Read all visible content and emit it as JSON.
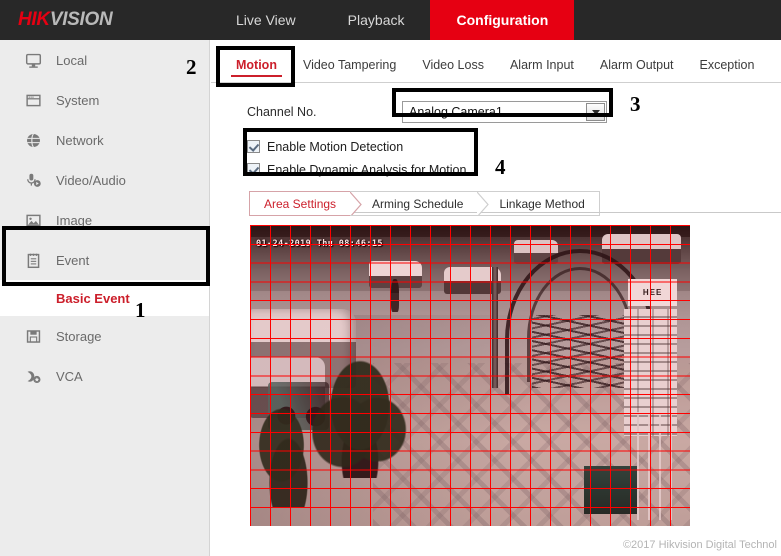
{
  "header": {
    "logo_hik": "HIK",
    "logo_vision": "VISION",
    "nav": [
      {
        "label": "Live View",
        "active": false
      },
      {
        "label": "Playback",
        "active": false
      },
      {
        "label": "Configuration",
        "active": true
      }
    ],
    "accent_color": "#e60012",
    "bar_color": "#282828"
  },
  "sidebar": {
    "items": [
      {
        "label": "Local",
        "icon": "monitor-icon"
      },
      {
        "label": "System",
        "icon": "window-icon"
      },
      {
        "label": "Network",
        "icon": "globe-icon"
      },
      {
        "label": "Video/Audio",
        "icon": "microphone-icon"
      },
      {
        "label": "Image",
        "icon": "picture-icon"
      },
      {
        "label": "Event",
        "icon": "clipboard-icon"
      },
      {
        "label": "Storage",
        "icon": "floppy-disk-icon"
      },
      {
        "label": "VCA",
        "icon": "vca-icon"
      }
    ],
    "sub_item": {
      "label": "Basic Event",
      "active": true,
      "color": "#cc1f2b"
    }
  },
  "tabs": [
    {
      "label": "Motion",
      "active": true
    },
    {
      "label": "Video Tampering",
      "active": false
    },
    {
      "label": "Video Loss",
      "active": false
    },
    {
      "label": "Alarm Input",
      "active": false
    },
    {
      "label": "Alarm Output",
      "active": false
    },
    {
      "label": "Exception",
      "active": false
    }
  ],
  "channel": {
    "label": "Channel No.",
    "selected": "Analog Camera1",
    "options": [
      "Analog Camera1"
    ]
  },
  "checkboxes": [
    {
      "label": "Enable Motion Detection",
      "checked": true
    },
    {
      "label": "Enable Dynamic Analysis for Motion",
      "checked": true
    }
  ],
  "subtabs": [
    {
      "label": "Area Settings",
      "active": true
    },
    {
      "label": "Arming Schedule",
      "active": false
    },
    {
      "label": "Linkage Method",
      "active": false
    }
  ],
  "video": {
    "timestamp": "01-24-2019 Thu 08:46:15",
    "grid_color": "#ff0000",
    "grid_columns": 22,
    "grid_rows": 16,
    "sign_text": "HEE"
  },
  "annotations": [
    {
      "number": "1",
      "target": "sidebar-event-section"
    },
    {
      "number": "2",
      "target": "motion-tab"
    },
    {
      "number": "3",
      "target": "channel-dropdown"
    },
    {
      "number": "4",
      "target": "enable-checkboxes"
    }
  ],
  "footer": {
    "copyright": "©2017 Hikvision Digital Technol"
  }
}
